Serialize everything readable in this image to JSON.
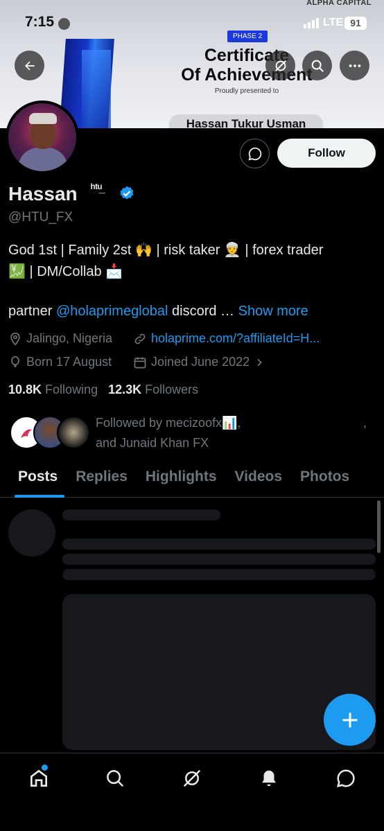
{
  "status_bar": {
    "time": "7:15",
    "network": "LTE",
    "battery": "91"
  },
  "banner": {
    "brand": "ALPHA CAPITAL",
    "phase": "PHASE 2",
    "title_line1": "Certificate",
    "title_line2": "Of Achievement",
    "subtitle": "Proudly presented to",
    "recipient": "Hassan Tukur Usman"
  },
  "profile": {
    "name": "Hassan",
    "name_suffix": "ʰᵗᵘ̲",
    "handle": "@HTU_FX",
    "follow_label": "Follow",
    "bio_line1": "God 1st | Family 2st 🙌 | risk taker 👳 | forex trader",
    "bio_line2": "💹 | DM/Collab 📩",
    "bio_partner_prefix": "partner ",
    "bio_partner_link": "@holaprimeglobal",
    "bio_partner_suffix": " discord … ",
    "show_more": "Show more",
    "location": "Jalingo, Nigeria",
    "website": "holaprime.com/?affiliateId=H...",
    "born": "Born 17 August",
    "joined": "Joined June 2022",
    "following_count": "10.8K",
    "following_label": " Following",
    "followers_count": "12.3K",
    "followers_label": " Followers",
    "followed_by_line1": "Followed by mecizoofx📊,",
    "followed_by_comma": ",",
    "followed_by_line2": "and Junaid Khan FX"
  },
  "tabs": [
    "Posts",
    "Replies",
    "Highlights",
    "Videos",
    "Photos"
  ],
  "colors": {
    "accent": "#1d9bf0",
    "background": "#000000",
    "muted": "#71767b",
    "text": "#e7e9ea"
  },
  "icons": {
    "back": "arrow-left-icon",
    "no_signal": "grok-icon",
    "search": "search-icon",
    "more": "more-icon",
    "message": "message-icon",
    "verified": "verified-badge-icon",
    "location": "location-icon",
    "link": "link-icon",
    "birthday": "balloon-icon",
    "calendar": "calendar-icon",
    "compose": "plus-icon",
    "home": "home-icon",
    "explore": "search-icon",
    "grok": "grok-icon",
    "notifications": "bell-icon",
    "messages": "message-icon"
  }
}
